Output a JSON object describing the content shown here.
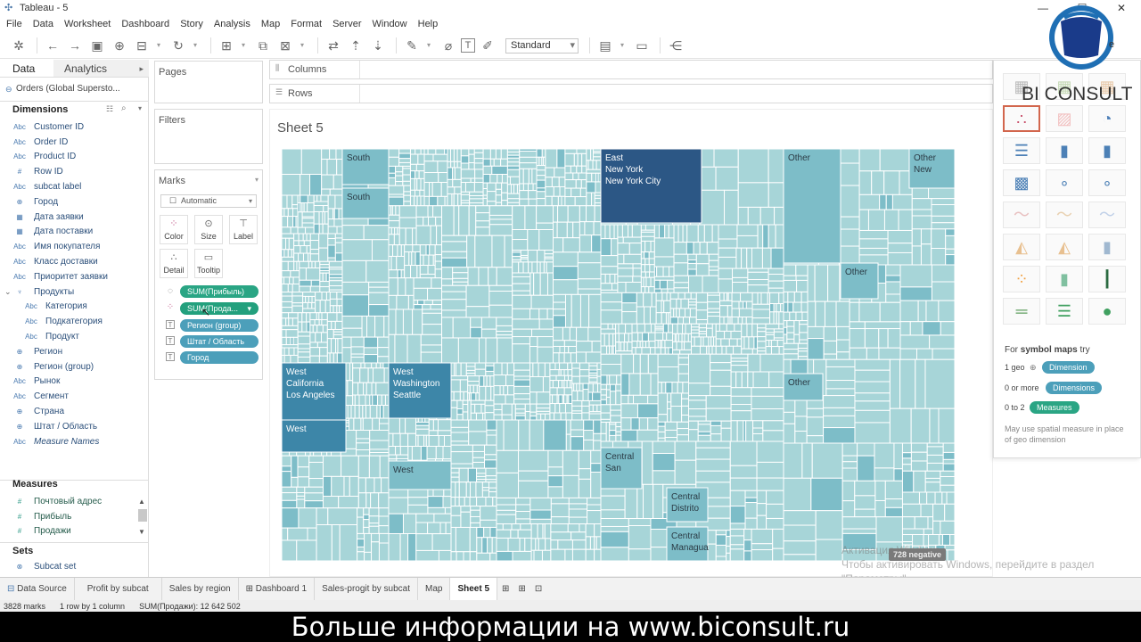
{
  "window": {
    "title": "Tableau - 5",
    "app_icon": "tableau-logo-icon"
  },
  "menu": [
    "File",
    "Data",
    "Worksheet",
    "Dashboard",
    "Story",
    "Analysis",
    "Map",
    "Format",
    "Server",
    "Window",
    "Help"
  ],
  "toolbar": {
    "fit": "Standard"
  },
  "left_pane": {
    "tabs": {
      "data": "Data",
      "analytics": "Analytics"
    },
    "datasource": "Orders (Global Supersto...",
    "dimensions_header": "Dimensions",
    "dimensions": [
      {
        "type": "Abc",
        "name": "Customer ID"
      },
      {
        "type": "Abc",
        "name": "Order ID"
      },
      {
        "type": "Abc",
        "name": "Product ID"
      },
      {
        "type": "#",
        "name": "Row ID"
      },
      {
        "type": "Abc",
        "name": "subcat label"
      },
      {
        "type": "geo",
        "name": "Город"
      },
      {
        "type": "cal",
        "name": "Дата заявки"
      },
      {
        "type": "cal",
        "name": "Дата поставки"
      },
      {
        "type": "Abc",
        "name": "Имя покупателя"
      },
      {
        "type": "Abc",
        "name": "Класс доставки"
      },
      {
        "type": "Abc",
        "name": "Приоритет заявки"
      },
      {
        "type": "hier",
        "name": "Продукты"
      },
      {
        "type": "Abc",
        "name": "Категория"
      },
      {
        "type": "Abc",
        "name": "Подкатегория"
      },
      {
        "type": "Abc",
        "name": "Продукт"
      },
      {
        "type": "geo",
        "name": "Регион"
      },
      {
        "type": "geo",
        "name": "Регион (group)"
      },
      {
        "type": "Abc",
        "name": "Рынок"
      },
      {
        "type": "Abc",
        "name": "Сегмент"
      },
      {
        "type": "geo",
        "name": "Страна"
      },
      {
        "type": "geo",
        "name": "Штат / Область"
      },
      {
        "type": "Abc",
        "name": "Measure Names"
      }
    ],
    "measures_header": "Measures",
    "measures": [
      {
        "type": "#",
        "name": "Почтовый адрес"
      },
      {
        "type": "#",
        "name": "Прибыль"
      },
      {
        "type": "#",
        "name": "Продажи"
      }
    ],
    "sets_header": "Sets",
    "sets": [
      {
        "type": "set",
        "name": "Subcat set"
      }
    ]
  },
  "cards": {
    "pages": "Pages",
    "filters": "Filters",
    "marks": "Marks",
    "mark_type": "Automatic",
    "buttons": {
      "color": "Color",
      "size": "Size",
      "label": "Label",
      "detail": "Detail",
      "tooltip": "Tooltip"
    },
    "pills": [
      "SUM(Прибыль)",
      "SUM(Прода...",
      "Регион (group)",
      "Штат / Область",
      "Город"
    ]
  },
  "shelves": {
    "columns": "Columns",
    "rows": "Rows"
  },
  "sheet": {
    "title": "Sheet 5"
  },
  "chart_data": {
    "type": "treemap",
    "size_measure": "SUM(Продажи)",
    "color_measure": "SUM(Прибыль)",
    "labels": [
      [
        "East",
        "New York",
        "New York City"
      ],
      [
        "West",
        "California",
        "Los Angeles"
      ],
      [
        "West",
        "Washington",
        "Seattle"
      ],
      [
        "West"
      ],
      [
        "West"
      ],
      [
        "South"
      ],
      [
        "South"
      ],
      [
        "Other"
      ],
      [
        "Other",
        "New"
      ],
      [
        "Other"
      ],
      [
        "Other"
      ],
      [
        "Central",
        "San"
      ],
      [
        "Central",
        "Distrito"
      ],
      [
        "Central",
        "Managua"
      ]
    ],
    "colors": {
      "light": "#a7d5d8",
      "mid": "#7dbdc8",
      "dark": "#3d86a8",
      "darkest": "#2c5785"
    }
  },
  "show_me": {
    "hint_prefix": "For ",
    "hint_bold": "symbol maps",
    "hint_suffix": " try",
    "req": [
      {
        "count": "1 geo",
        "pill": "Dimension"
      },
      {
        "count": "0 or more",
        "pill": "Dimensions"
      },
      {
        "count": "0 to 2",
        "pill": "Measures"
      }
    ],
    "note": "May use spatial measure in place of geo dimension"
  },
  "tabs_bottom": [
    "Data Source",
    "Profit by subcat",
    "Sales by region",
    "Dashboard 1",
    "Sales-progit by subcat",
    "Map",
    "Sheet 5"
  ],
  "status": {
    "marks": "3828 marks",
    "grid": "1 row by 1 column",
    "sum": "SUM(Продажи): 12 642 502"
  },
  "negative_badge": "728 negative",
  "watermark": {
    "line1": "Активация Windows",
    "line2": "Чтобы активировать Windows, перейдите в раздел",
    "line3": "\"Параметры\"."
  },
  "logo": {
    "text": "BI CONSULT",
    "partial": "e"
  },
  "banner": "Больше информации на www.biconsult.ru"
}
